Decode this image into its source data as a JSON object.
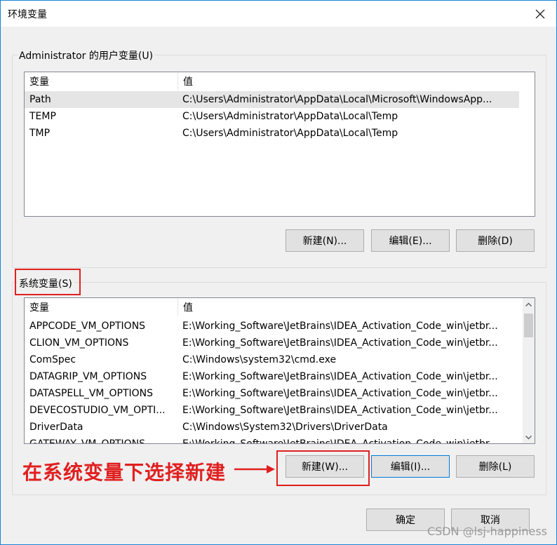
{
  "window": {
    "title": "环境变量",
    "close_icon": "close-icon"
  },
  "user_vars": {
    "group_label": "Administrator 的用户变量(U)",
    "headers": [
      "变量",
      "值"
    ],
    "rows": [
      {
        "name": "Path",
        "value": "C:\\Users\\Administrator\\AppData\\Local\\Microsoft\\WindowsApp..."
      },
      {
        "name": "TEMP",
        "value": "C:\\Users\\Administrator\\AppData\\Local\\Temp"
      },
      {
        "name": "TMP",
        "value": "C:\\Users\\Administrator\\AppData\\Local\\Temp"
      }
    ],
    "buttons": {
      "new": "新建(N)...",
      "edit": "编辑(E)...",
      "delete": "删除(D)"
    }
  },
  "system_vars": {
    "group_label": "系统变量(S)",
    "headers": [
      "变量",
      "值"
    ],
    "rows": [
      {
        "name": "APPCODE_VM_OPTIONS",
        "value": "E:\\Working_Software\\JetBrains\\IDEA_Activation_Code_win\\jetbr..."
      },
      {
        "name": "CLION_VM_OPTIONS",
        "value": "E:\\Working_Software\\JetBrains\\IDEA_Activation_Code_win\\jetbr..."
      },
      {
        "name": "ComSpec",
        "value": "C:\\Windows\\system32\\cmd.exe"
      },
      {
        "name": "DATAGRIP_VM_OPTIONS",
        "value": "E:\\Working_Software\\JetBrains\\IDEA_Activation_Code_win\\jetbr..."
      },
      {
        "name": "DATASPELL_VM_OPTIONS",
        "value": "E:\\Working_Software\\JetBrains\\IDEA_Activation_Code_win\\jetbr..."
      },
      {
        "name": "DEVECOSTUDIO_VM_OPTI...",
        "value": "E:\\Working_Software\\JetBrains\\IDEA_Activation_Code_win\\jetbr..."
      },
      {
        "name": "DriverData",
        "value": "C:\\Windows\\System32\\Drivers\\DriverData"
      },
      {
        "name": "GATEWAY_VM_OPTIONS",
        "value": "E:\\Working_Software\\JetBrains\\IDEA_Activation_Code_win\\jetbr..."
      }
    ],
    "buttons": {
      "new": "新建(W)...",
      "edit": "编辑(I)...",
      "delete": "删除(L)"
    }
  },
  "footer": {
    "ok": "确定",
    "cancel": "取消"
  },
  "annotation": {
    "text": "在系统变量下选择新建",
    "color": "#e02020"
  },
  "watermark": "CSDN @lsj-happiness"
}
